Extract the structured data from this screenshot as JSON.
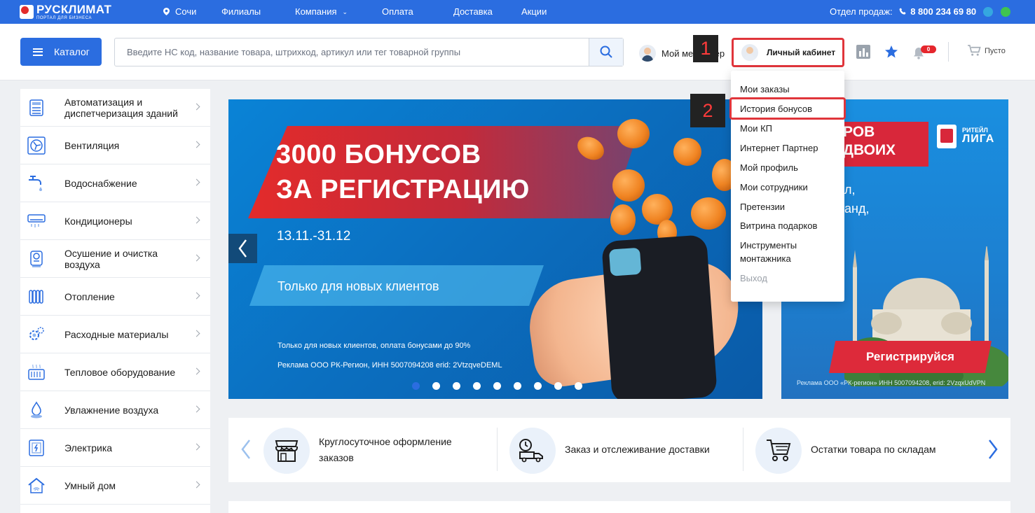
{
  "topbar": {
    "logo_main": "РУСКЛИМАТ",
    "logo_sub": "ПОРТАЛ ДЛЯ БИЗНЕСА",
    "city": "Сочи",
    "nav": [
      "Филиалы",
      "Компания",
      "Оплата",
      "Доставка",
      "Акции"
    ],
    "sales_label": "Отдел продаж:",
    "phone": "8 800 234 69 80"
  },
  "header": {
    "catalog_label": "Каталог",
    "search_placeholder": "Введите НС код, название товара, штрихкод, артикул или тег товарной группы",
    "manager_label": "Мой менеджер",
    "cabinet_label": "Личный кабинет",
    "notifications_count": "0",
    "cart_label": "Пусто"
  },
  "annotations": {
    "step1": "1",
    "step2": "2"
  },
  "dropdown": {
    "items": [
      "Мои заказы",
      "История бонусов",
      "Мои КП",
      "Интернет Партнер",
      "Мой профиль",
      "Мои сотрудники",
      "Претензии",
      "Витрина подарков",
      "Инструменты монтажника",
      "Выход"
    ],
    "highlighted": "История бонусов"
  },
  "sidebar": {
    "items": [
      {
        "label": "Автоматизация и диспетчеризация зданий",
        "icon": "building-automation-icon"
      },
      {
        "label": "Вентиляция",
        "icon": "ventilation-icon"
      },
      {
        "label": "Водоснабжение",
        "icon": "faucet-icon"
      },
      {
        "label": "Кондиционеры",
        "icon": "air-conditioner-icon"
      },
      {
        "label": "Осушение и очистка воздуха",
        "icon": "air-purifier-icon"
      },
      {
        "label": "Отопление",
        "icon": "radiator-icon"
      },
      {
        "label": "Расходные материалы",
        "icon": "gears-icon"
      },
      {
        "label": "Тепловое оборудование",
        "icon": "heater-icon"
      },
      {
        "label": "Увлажнение воздуха",
        "icon": "humidifier-icon"
      },
      {
        "label": "Электрика",
        "icon": "electric-panel-icon"
      },
      {
        "label": "Умный дом",
        "icon": "smart-home-icon"
      }
    ]
  },
  "banner": {
    "title_line1": "3000 БОНУСОВ",
    "title_line2": "ЗА РЕГИСТРАЦИЮ",
    "date": "13.11.-31.12",
    "pill": "Только для новых клиентов",
    "note1": "Только для новых клиентов, оплата бонусами до 90%",
    "note2": "Реклама ООО РК-Регион, ИНН 5007094208 erid: 2VtzqveDEML",
    "dots_total": 9,
    "active_dot": 1
  },
  "banner2": {
    "title_line1": "РОВ",
    "title_line2": "ДВОИХ",
    "text_line1": "л,",
    "text_line2": "анд,",
    "liga_small": "РИТЕЙЛ",
    "liga_large": "ЛИГА",
    "cta": "Регистрируйся",
    "footer": "Реклама ООО «РК-регион» ИНН 5007094208, erid: 2VzqxUdVPN"
  },
  "features": [
    {
      "text_line1": "Круглосуточное оформление",
      "text_line2": "заказов",
      "icon": "shop-icon"
    },
    {
      "text_line1": "Заказ и отслеживание доставки",
      "text_line2": "",
      "icon": "delivery-truck-icon"
    },
    {
      "text_line1": "Остатки товара по складам",
      "text_line2": "",
      "icon": "shopping-cart-icon"
    }
  ],
  "colors": {
    "brand_blue": "#2b6de0",
    "highlight_red": "#e0353b",
    "badge_red": "#e5262d"
  }
}
